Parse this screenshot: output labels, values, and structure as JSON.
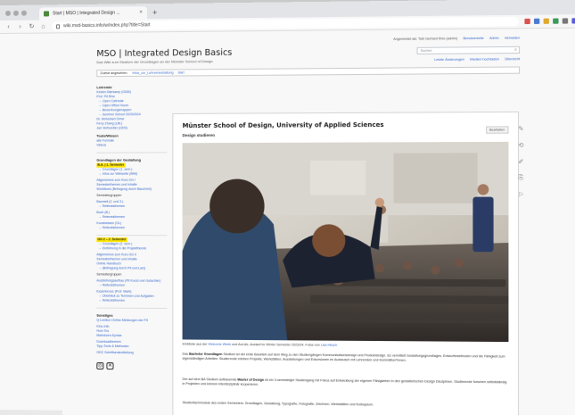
{
  "browser": {
    "tab_title": "Start | MSO | Integrated Design ...",
    "tab_close": "×",
    "new_tab": "+",
    "url": "wiki.msd-basics.info/w/index.php?title=Start",
    "nav": {
      "back": "‹",
      "forward": "›",
      "reload": "↻",
      "home": "⌂"
    }
  },
  "wiki": {
    "title": "MSO | Integrated Design Basics",
    "subtitle": "Das Wiki zum Studium der Grundlagen an der Münster School of Design",
    "userlinks": [
      {
        "label": "Angemeldet als: Tobi Gerhard Rixe (admin)",
        "plain": true
      },
      {
        "label": "Benutzerseite"
      },
      {
        "label": "Admin"
      },
      {
        "label": "Abmelden"
      }
    ],
    "search_placeholder": "Suchen",
    "search_icon": "⌕",
    "actions": [
      "Letzte Änderungen",
      "Medien hochladen",
      "Übersicht"
    ],
    "breadcrumb_label": "Zuletzt angesehen:",
    "breadcrumb_items": [
      "Infos_zur_Lehrveranstaltung",
      "start"
    ]
  },
  "sidebar": {
    "sections": [
      {
        "heading": "Lehrende",
        "items": [
          "Kirsten Bierkamp (GDM)",
          "Prof. Pit Rixe",
          "→ Open Calendar",
          "→ Open Office Hours",
          "→ Bewerbungsmappen",
          "→ Summer School 2023/2024",
          "Dr. Mohamed Omar",
          "Ferry Zhang (LBL)",
          "Jan Verbundler (GDS)"
        ]
      },
      {
        "heading": "Tools/Wissen",
        "items": [
          "alle Formate",
          "Videos"
        ]
      },
      {
        "heading": "Grundlagen der Gestaltung",
        "highlight": "B.A. | 1. Semester",
        "items": [
          "→ Grundlagen (1. sem.)",
          "→ Infos zur Webseite (Wiki)",
          "Allgemeines zum Kurs GG I",
          "Semesterthemen und Inhalte",
          "Workflows (Befragung durch Bauchrixt)",
          "Semestergruppen",
          "Baumeit (2. und 3.)",
          "→ Referatsthemen",
          "Buch (B.)",
          "→ Referatsthemen",
          "Kunstwissen (GL)",
          "→ Referatsthemen"
        ]
      },
      {
        "highlight": "GG 2 – 2. Semester",
        "items": [
          "→ Grundlagen (2. sem.)",
          "→ Einführung in die Projekttheorie",
          "Allgemeines zum Kurs GG II",
          "Semesterthemen und Inhalte",
          "Online Handbuch",
          "→ (Befragung durch Pit und Lars)",
          "Semestergruppen",
          "Ausstellungsaufbau (Pit Kunst und Gutachter)",
          "→ Referatsthemen",
          "Experiences (Prof. Mark)",
          "→ Überblick zu Terminen und Aufgaben",
          "→ Referatsthemen"
        ]
      },
      {
        "heading": "Sonstiges",
        "items": [
          "Q-Lexikon Online-Meldungen der FH",
          "Kino-Info",
          "How-Tos",
          "Markdown-Syntax",
          "Downloadbereich",
          "Tipp-Tools & Methoden",
          "GDC Schriftsenkmitteilung"
        ]
      }
    ],
    "social": [
      "◎",
      "✕"
    ]
  },
  "content": {
    "heading": "Münster School of Design, University of Applied Sciences",
    "subheading": "Design studieren",
    "edit_label": "Bearbeiten",
    "caption_prefix": "Einblicke aus der",
    "caption_link": "Welcome Week",
    "caption_suffix": "und Auf-Ab, Auslauf im Winter Semester 2023/24, Fotos von",
    "caption_credit": "Lisa Hirsch",
    "para1_lead": "Das",
    "para1_bold": "Bachelor Grundlagen",
    "para1_text": "Studium ist der erste Baustein auf dem Weg zu den Studiengängen Kommunikationsdesign und Produktdesign. Es vermittelt Gestaltungsgrundlagen, Entwurfsmethoden und die Fähigkeit zum eigenständigen Arbeiten. Studierende erleben Projekte, Werkstätten, Ausstellungen und Exkursionen im Austausch mit Lehrenden und Kommiliton*innen.",
    "para2_lead": "Der auf dem BA Studium aufbauende",
    "para2_bold": "Master of Design",
    "para2_text": "ist ein 3-semestriger Studiengang mit Fokus auf Entwicklung der eigenen Fähigkeiten in den gestalterischen Design Disziplinen. Studierende forschen selbstständig in Projekten und können interdisziplinär kooperieren.",
    "para3_text": "Studienfachmodule des ersten Semesters: Grundlagen, Gestaltung, Typografie, Fotografie, Zeichnen, Werkstätten und Kolloquium."
  },
  "tools": [
    "✎",
    "⟲",
    "✐",
    "⎘",
    "⚐"
  ]
}
